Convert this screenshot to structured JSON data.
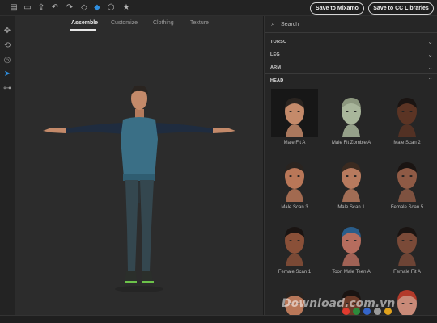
{
  "toolbar": {
    "tools": [
      "new-icon",
      "open-icon",
      "export-icon",
      "undo-icon",
      "redo-icon",
      "cube-outline-icon",
      "cube-solid-icon",
      "cube-wire-icon",
      "star-icon"
    ],
    "active_tool": "cube-solid-icon",
    "save_mixamo_label": "Save to Mixamo",
    "save_cc_label": "Save to CC Libraries"
  },
  "rail": {
    "tools": [
      "move-icon",
      "rotate-icon",
      "orbit-icon",
      "select-arrow-icon",
      "hierarchy-icon"
    ],
    "active_tool": "select-arrow-icon"
  },
  "viewport": {
    "tabs": [
      {
        "label": "Assemble",
        "active": true
      },
      {
        "label": "Customize",
        "active": false
      },
      {
        "label": "Clothing",
        "active": false
      },
      {
        "label": "Texture",
        "active": false
      }
    ]
  },
  "panel": {
    "search": {
      "placeholder": "Search",
      "value": ""
    },
    "categories": [
      {
        "label": "TORSO",
        "expanded": false
      },
      {
        "label": "LEG",
        "expanded": false
      },
      {
        "label": "ARM",
        "expanded": false
      },
      {
        "label": "HEAD",
        "expanded": true
      }
    ],
    "heads": [
      {
        "label": "Male Fit A",
        "selected": true
      },
      {
        "label": "Male Fit Zombie A",
        "selected": false
      },
      {
        "label": "Male Scan 2",
        "selected": false
      },
      {
        "label": "Male Scan 3",
        "selected": false
      },
      {
        "label": "Male Scan 1",
        "selected": false
      },
      {
        "label": "Female Scan 5",
        "selected": false
      },
      {
        "label": "Female Scan 1",
        "selected": false
      },
      {
        "label": "Toon Male Teen A",
        "selected": false
      },
      {
        "label": "Female Fit A",
        "selected": false
      },
      {
        "label": "",
        "selected": false
      },
      {
        "label": "",
        "selected": false
      },
      {
        "label": "",
        "selected": false
      }
    ]
  },
  "watermark": {
    "text": "Download.com.vn",
    "colors": [
      "#e03b2f",
      "#2c8a3c",
      "#3565c9",
      "#9a9a9a",
      "#e0a21d"
    ]
  },
  "colors": {
    "accent": "#2f8fe0",
    "shirt": "#3a6f86",
    "sleeves": "#1f2c3f",
    "pants": "#34474f",
    "skin": "#c48a6a",
    "zombie_skin": "#a9b69b"
  }
}
